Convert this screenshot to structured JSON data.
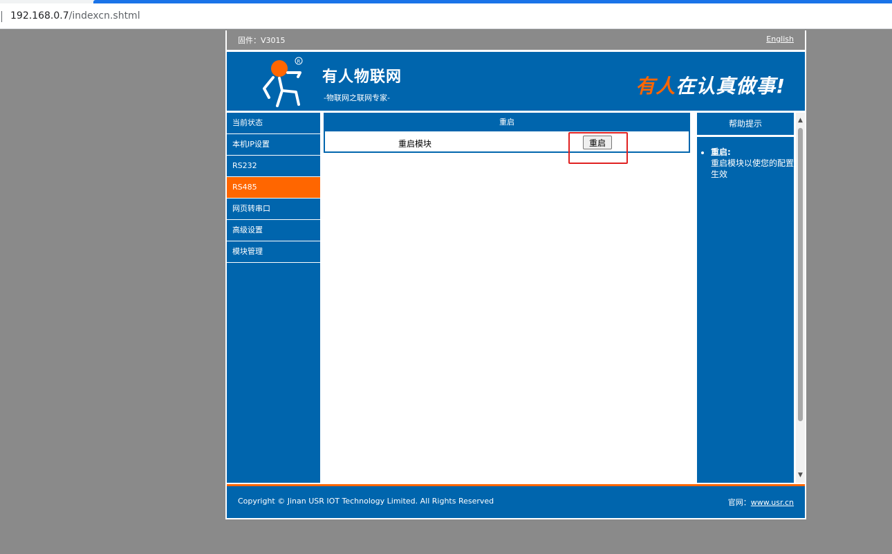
{
  "browser": {
    "url_host": "192.168.0.7",
    "url_path": "/indexcn.shtml"
  },
  "top": {
    "firmware": "固件：V3015",
    "language_link": "English"
  },
  "header": {
    "brand": "有人物联网",
    "subtitle": "-物联网之联网专家-",
    "slogan_highlight": "有人",
    "slogan_rest": "在认真做事!",
    "registered_mark": "R"
  },
  "sidebar": {
    "items": [
      {
        "label": "当前状态"
      },
      {
        "label": "本机IP设置"
      },
      {
        "label": "RS232"
      },
      {
        "label": "RS485"
      },
      {
        "label": "网页转串口"
      },
      {
        "label": "高级设置"
      },
      {
        "label": "模块管理"
      }
    ],
    "active_index": 3
  },
  "main": {
    "panel_title": "重启",
    "row_label": "重启模块",
    "button_label": "重启"
  },
  "help": {
    "title": "帮助提示",
    "term": "重启:",
    "description": "重启模块以使您的配置生效"
  },
  "footer": {
    "copyright": "Copyright © Jinan USR IOT Technology Limited. All Rights Reserved",
    "site_label": "官网：",
    "site_link": "www.usr.cn"
  },
  "colors": {
    "brand_blue": "#0065ad",
    "accent_orange": "#ff6600",
    "highlight_red": "#e02020"
  }
}
